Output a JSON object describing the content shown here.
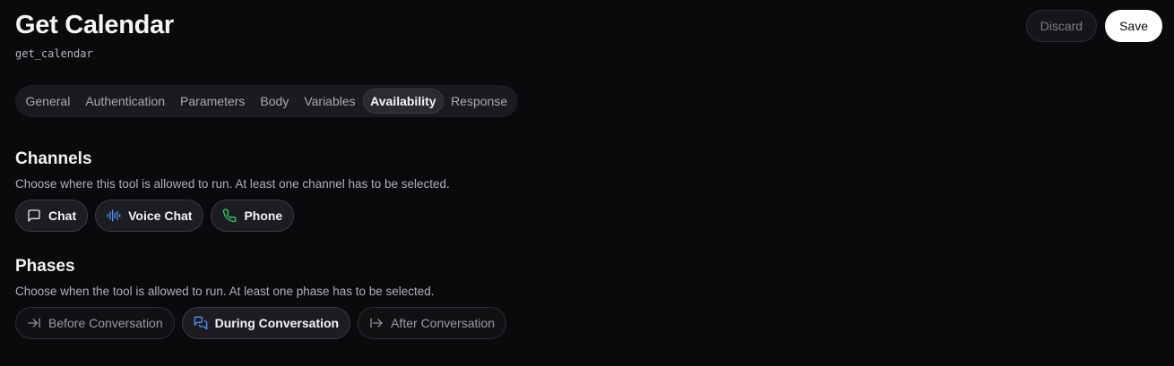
{
  "header": {
    "title": "Get Calendar",
    "slug": "get_calendar",
    "discard_label": "Discard",
    "save_label": "Save"
  },
  "tabs": [
    {
      "label": "General",
      "active": false
    },
    {
      "label": "Authentication",
      "active": false
    },
    {
      "label": "Parameters",
      "active": false
    },
    {
      "label": "Body",
      "active": false
    },
    {
      "label": "Variables",
      "active": false
    },
    {
      "label": "Availability",
      "active": true
    },
    {
      "label": "Response",
      "active": false
    }
  ],
  "channels": {
    "title": "Channels",
    "description": "Choose where this tool is allowed to run. At least one channel has to be selected.",
    "options": [
      {
        "label": "Chat",
        "icon": "message-square-icon",
        "selected": true,
        "icon_color": "#e8e8ea"
      },
      {
        "label": "Voice Chat",
        "icon": "audio-waveform-icon",
        "selected": true,
        "icon_color": "#4f8ef7"
      },
      {
        "label": "Phone",
        "icon": "phone-icon",
        "selected": true,
        "icon_color": "#2fcf6b"
      }
    ]
  },
  "phases": {
    "title": "Phases",
    "description": "Choose when the tool is allowed to run. At least one phase has to be selected.",
    "options": [
      {
        "label": "Before Conversation",
        "icon": "arrow-right-to-line-icon",
        "selected": false,
        "icon_color": "#8e8e95"
      },
      {
        "label": "During Conversation",
        "icon": "messages-icon",
        "selected": true,
        "icon_color": "#4f8ef7"
      },
      {
        "label": "After Conversation",
        "icon": "arrow-right-from-line-icon",
        "selected": false,
        "icon_color": "#8e8e95"
      }
    ]
  }
}
